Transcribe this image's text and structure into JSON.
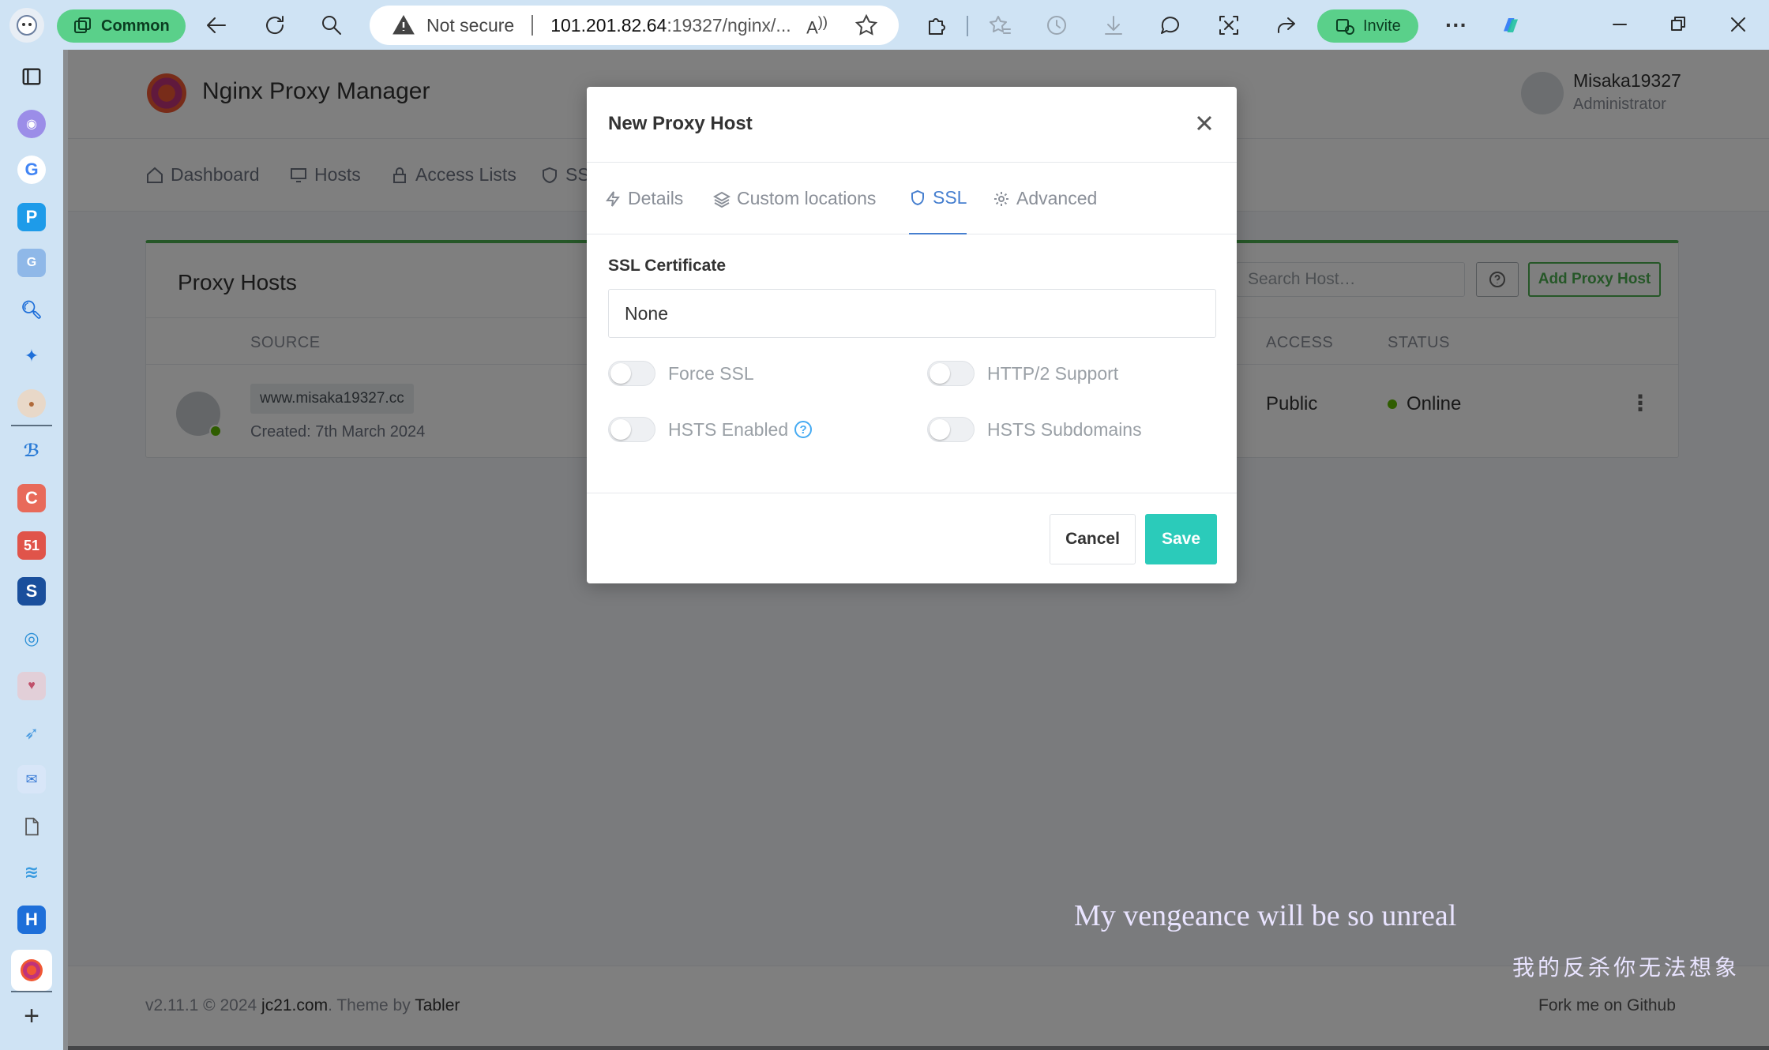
{
  "browser": {
    "workspace_label": "Common",
    "address": {
      "security": "Not secure",
      "host": "101.201.82.64",
      "rest": ":19327/nginx/..."
    },
    "read_aloud": "A",
    "invite_label": "Invite"
  },
  "app": {
    "brand": "Nginx Proxy Manager",
    "user": {
      "name": "Misaka19327",
      "role": "Administrator"
    },
    "nav": [
      "Dashboard",
      "Hosts",
      "Access Lists",
      "SSL"
    ],
    "card": {
      "title": "Proxy Hosts",
      "search_placeholder": "Search Host…",
      "add_label": "Add Proxy Host",
      "columns": {
        "source": "SOURCE",
        "access": "ACCESS",
        "status": "STATUS"
      },
      "row": {
        "domain": "www.misaka19327.cc",
        "created": "Created: 7th March 2024",
        "access": "Public",
        "status": "Online"
      }
    },
    "footer": {
      "version": "v2.11.1 © 2024 ",
      "site": "jc21.com",
      "theme": ". Theme by ",
      "theme_name": "Tabler",
      "fork": "Fork me on Github"
    }
  },
  "modal": {
    "title": "New Proxy Host",
    "tabs": [
      "Details",
      "Custom locations",
      "SSL",
      "Advanced"
    ],
    "active_tab": "SSL",
    "ssl_label": "SSL Certificate",
    "ssl_value": "None",
    "toggles": {
      "force_ssl": "Force SSL",
      "http2": "HTTP/2 Support",
      "hsts": "HSTS Enabled",
      "hsts_sub": "HSTS Subdomains"
    },
    "help_icon": "?",
    "cancel": "Cancel",
    "save": "Save"
  },
  "subtitles": {
    "en": "My vengeance will be so unreal",
    "cn": "我的反杀你无法想象"
  },
  "colors": {
    "accent_green": "#4caf50",
    "tab_active": "#467fcf",
    "save_teal": "#2bcbba",
    "online": "#5eba00",
    "browser_chrome": "#cfe3f4"
  }
}
